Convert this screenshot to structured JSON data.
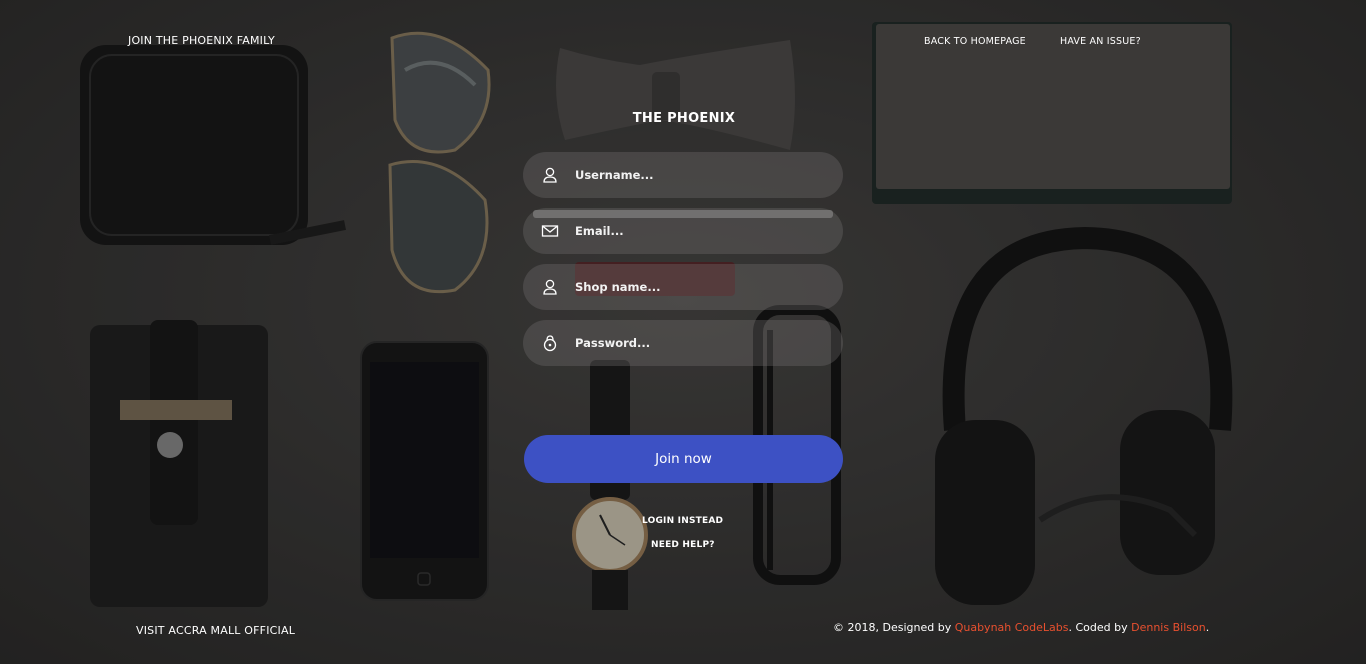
{
  "nav": {
    "join_family": "JOIN THE PHOENIX FAMILY",
    "back_home": "BACK TO HOMEPAGE",
    "have_issue": "HAVE AN ISSUE?",
    "visit_mall": "VISIT ACCRA MALL OFFICIAL"
  },
  "form": {
    "brand": "THE PHOENIX",
    "username_placeholder": "Username...",
    "email_placeholder": "Email...",
    "shop_placeholder": "Shop name...",
    "password_placeholder": "Password...",
    "join_label": "Join now",
    "login_instead": "LOGIN INSTEAD",
    "need_help": "NEED HELP?"
  },
  "footer": {
    "prefix": "© 2018, Designed by ",
    "designer": "Quabynah CodeLabs",
    "middle": ". Coded by ",
    "coder": "Dennis Bilson",
    "suffix": "."
  },
  "colors": {
    "accent": "#e8502f",
    "button": "#3d51c4",
    "background": "#2f2e2d"
  },
  "icons": {
    "username": "user-icon",
    "email": "envelope-icon",
    "shop": "user-icon",
    "password": "lock-icon"
  }
}
